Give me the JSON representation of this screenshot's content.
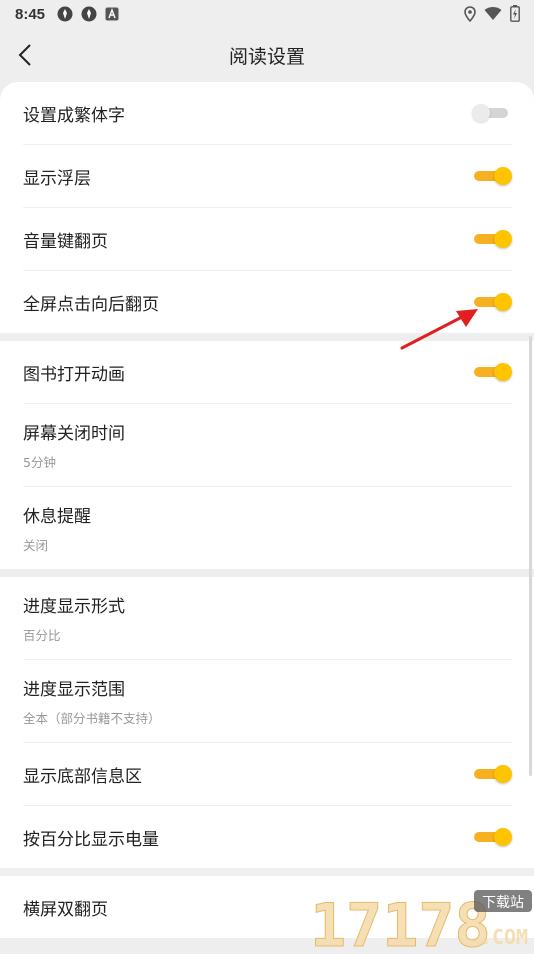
{
  "status_bar": {
    "time": "8:45",
    "left_icons": [
      "settings-app-icon",
      "settings-app-icon",
      "a-box-icon"
    ],
    "right_icons": [
      "location-icon",
      "wifi-icon",
      "battery-icon"
    ]
  },
  "header": {
    "title": "阅读设置",
    "back_icon": "chevron-left-icon"
  },
  "accent_color": "#ffc400",
  "groups": [
    {
      "items": [
        {
          "label": "设置成繁体字",
          "toggle": false
        },
        {
          "label": "显示浮层",
          "toggle": true
        },
        {
          "label": "音量键翻页",
          "toggle": true
        },
        {
          "label": "全屏点击向后翻页",
          "toggle": true
        }
      ]
    },
    {
      "items": [
        {
          "label": "图书打开动画",
          "toggle": true
        },
        {
          "label": "屏幕关闭时间",
          "value": "5分钟"
        },
        {
          "label": "休息提醒",
          "value": "关闭"
        }
      ]
    },
    {
      "items": [
        {
          "label": "进度显示形式",
          "value": "百分比"
        },
        {
          "label": "进度显示范围",
          "value": "全本（部分书籍不支持）"
        },
        {
          "label": "显示底部信息区",
          "toggle": true
        },
        {
          "label": "按百分比显示电量",
          "toggle": true
        }
      ]
    },
    {
      "items": [
        {
          "label": "横屏双翻页"
        }
      ]
    }
  ],
  "annotation": {
    "type": "red-arrow-icon",
    "color": "#e02020"
  },
  "watermark": {
    "text": "17178",
    "badge": "下载站",
    "suffix": ".COM"
  }
}
